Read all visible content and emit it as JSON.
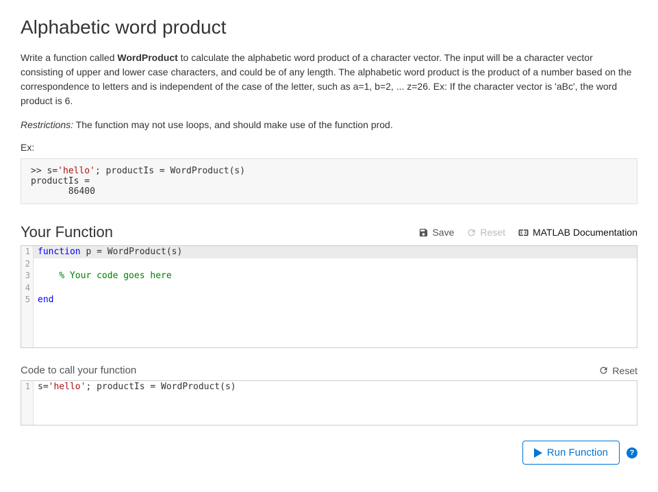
{
  "title": "Alphabetic word product",
  "description": {
    "prefix": "Write a function called ",
    "fn_name": "WordProduct",
    "rest": " to calculate the alphabetic word product of a character vector.  The input will be a character vector consisting of upper and lower case characters, and could be of any length. The alphabetic word product is the product of a number based on the correspondence to letters and is independent of the case of the letter, such as a=1, b=2, ... z=26.  Ex: If the character vector is 'aBc', the word product is 6."
  },
  "restrictions": {
    "label": "Restrictions:",
    "text": "  The function may not use loops, and should make use of the function prod."
  },
  "ex_label": "Ex:",
  "sample": {
    "line1_prefix": ">> s=",
    "line1_str": "'hello'",
    "line1_suffix": "; productIs = WordProduct(s)",
    "line2": "productIs =",
    "line3": "       86400"
  },
  "your_function_heading": "Your Function",
  "toolbar": {
    "save": "Save",
    "reset": "Reset",
    "doc": "MATLAB Documentation"
  },
  "editor": {
    "lines": [
      {
        "n": "1",
        "kw": "function",
        "rest": " p = WordProduct(s)",
        "hl": true
      },
      {
        "n": "2",
        "rest": ""
      },
      {
        "n": "3",
        "indent": "    ",
        "cm": "% Your code goes here"
      },
      {
        "n": "4",
        "rest": ""
      },
      {
        "n": "5",
        "kw": "end"
      }
    ]
  },
  "call_heading": "Code to call your function",
  "reset2": "Reset",
  "editor2": {
    "line": {
      "n": "1",
      "prefix": "s=",
      "str": "'hello'",
      "suffix": "; productIs = WordProduct(s)"
    }
  },
  "run_label": "Run Function",
  "help_char": "?"
}
